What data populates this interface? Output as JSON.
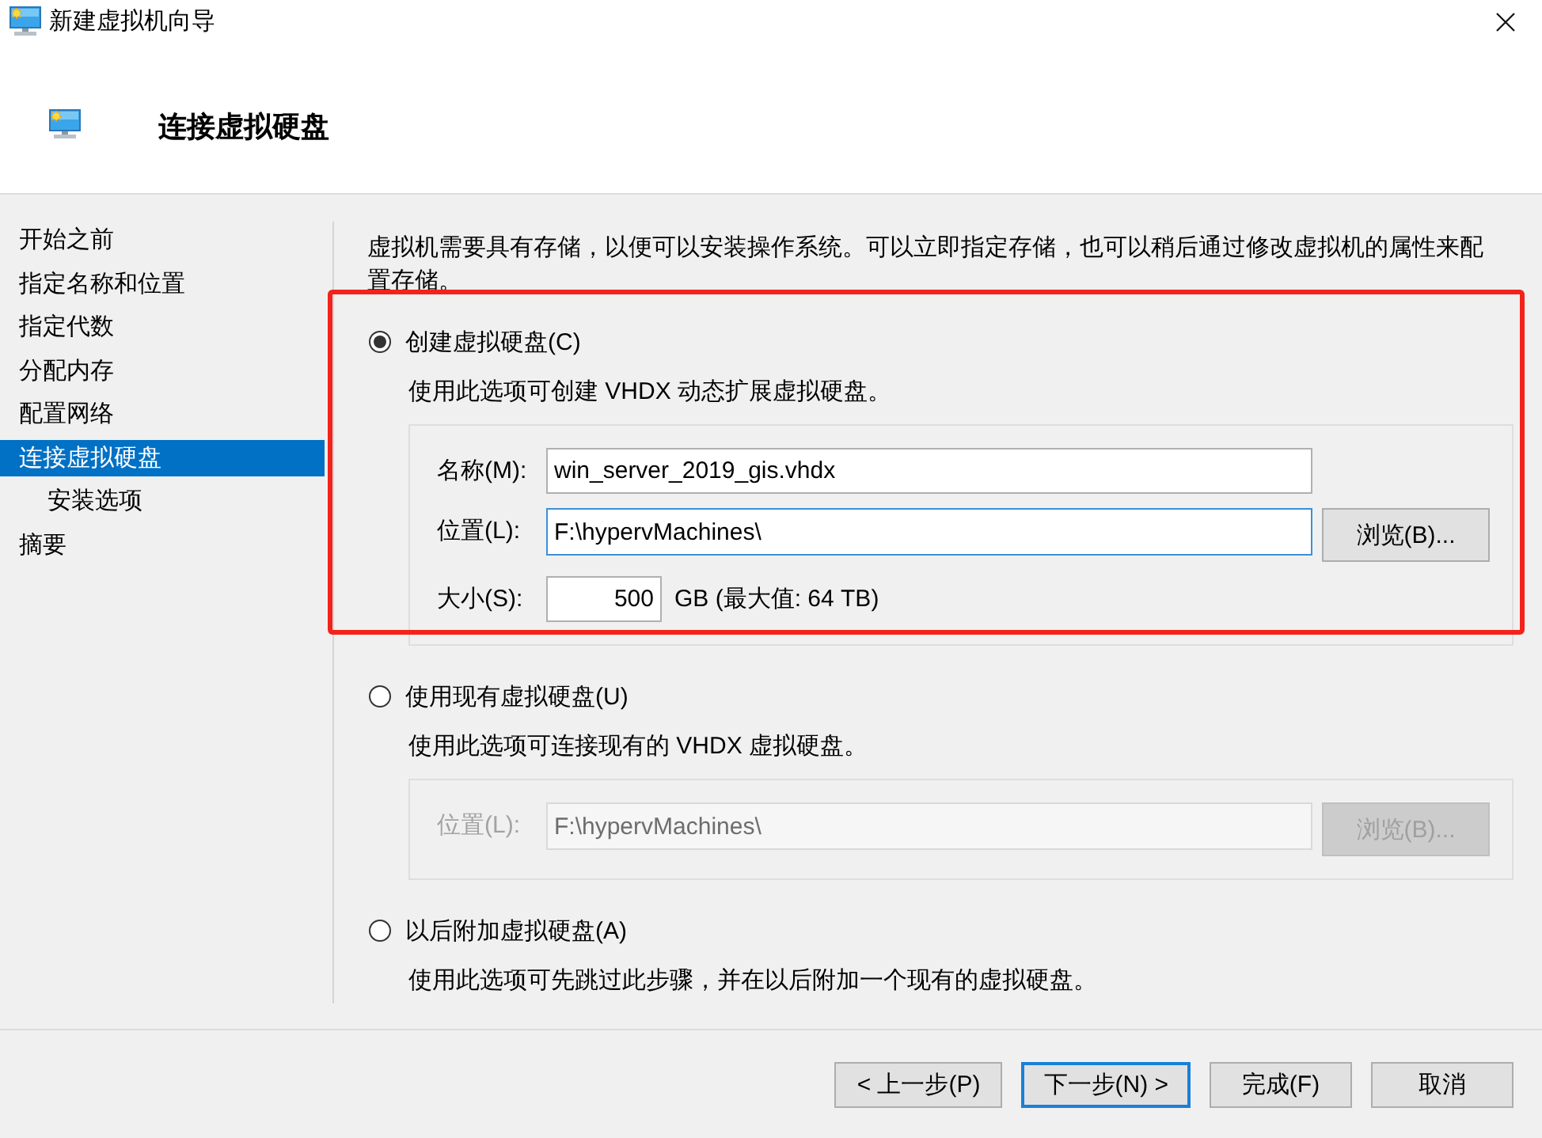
{
  "window": {
    "title": "新建虚拟机向导"
  },
  "header": {
    "title": "连接虚拟硬盘"
  },
  "sidebar": {
    "items": [
      {
        "label": "开始之前",
        "selected": false
      },
      {
        "label": "指定名称和位置",
        "selected": false
      },
      {
        "label": "指定代数",
        "selected": false
      },
      {
        "label": "分配内存",
        "selected": false
      },
      {
        "label": "配置网络",
        "selected": false
      },
      {
        "label": "连接虚拟硬盘",
        "selected": true,
        "children": [
          {
            "label": "安装选项",
            "selected": false
          }
        ]
      },
      {
        "label": "摘要",
        "selected": false
      }
    ]
  },
  "intro": "虚拟机需要具有存储，以便可以安装操作系统。可以立即指定存储，也可以稍后通过修改虚拟机的属性来配置存储。",
  "options": [
    {
      "label": "创建虚拟硬盘(C)",
      "selected": true,
      "highlighted": true,
      "description": "使用此选项可创建 VHDX 动态扩展虚拟硬盘。",
      "group": {
        "disabled": false,
        "fields": [
          {
            "kind": "text",
            "label": "名称(M):",
            "value": "win_server_2019_gis.vhdx",
            "focused": false
          },
          {
            "kind": "path",
            "label": "位置(L):",
            "value": "F:\\hypervMachines\\",
            "focused": true,
            "button": "浏览(B)..."
          },
          {
            "kind": "size",
            "label": "大小(S):",
            "value": "500",
            "focused": false,
            "unit": "GB (最大值: 64 TB)"
          }
        ]
      }
    },
    {
      "label": "使用现有虚拟硬盘(U)",
      "selected": false,
      "highlighted": false,
      "description": "使用此选项可连接现有的 VHDX 虚拟硬盘。",
      "group": {
        "disabled": true,
        "fields": [
          {
            "kind": "path",
            "label": "位置(L):",
            "value": "F:\\hypervMachines\\",
            "focused": false,
            "button": "浏览(B)..."
          }
        ]
      }
    },
    {
      "label": "以后附加虚拟硬盘(A)",
      "selected": false,
      "highlighted": false,
      "description": "使用此选项可先跳过此步骤，并在以后附加一个现有的虚拟硬盘。"
    }
  ],
  "buttons": [
    {
      "label": "< 上一步(P)",
      "focused": false
    },
    {
      "label": "下一步(N) >",
      "focused": true
    },
    {
      "label": "完成(F)",
      "focused": false
    },
    {
      "label": "取消",
      "focused": false
    }
  ]
}
